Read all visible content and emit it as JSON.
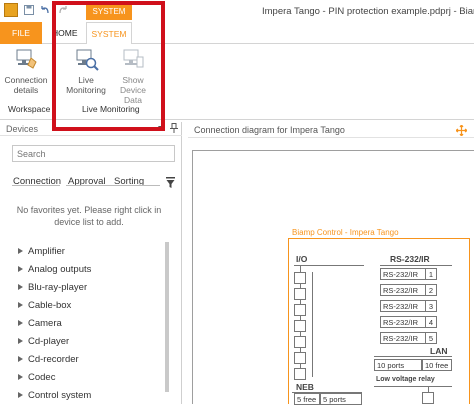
{
  "window": {
    "title": "Impera Tango - PIN protection example.pdprj - Biamp"
  },
  "ribbon": {
    "context_tab_header": "SYSTEM",
    "tabs": [
      {
        "label": "FILE"
      },
      {
        "label": "HOME"
      },
      {
        "label": "SYSTEM"
      }
    ],
    "workspace_group": {
      "label": "Workspace",
      "connection_details": "Connection details"
    },
    "live_monitoring_group": {
      "label": "Live Monitoring",
      "live_monitoring": "Live Monitoring",
      "show_device_data": "Show Device Data"
    }
  },
  "devices_panel": {
    "title": "Devices",
    "search_placeholder": "Search",
    "filters": [
      "Connection",
      "Approval",
      "Sorting"
    ],
    "no_favorites": "No favorites yet. Please right click in device list to add.",
    "items": [
      "Amplifier",
      "Analog outputs",
      "Blu-ray-player",
      "Cable-box",
      "Camera",
      "Cd-player",
      "Cd-recorder",
      "Codec",
      "Control system"
    ]
  },
  "diagram": {
    "title": "Connection diagram for Impera Tango",
    "device_title": "Biamp Control - Impera Tango",
    "sections": {
      "io": "I/O",
      "rs232": "RS-232/IR",
      "lan": "LAN",
      "neb": "NEB",
      "low_voltage_relay": "Low voltage relay"
    },
    "rs232_ports": [
      {
        "label": "RS-232/IR",
        "num": "1"
      },
      {
        "label": "RS-232/IR",
        "num": "2"
      },
      {
        "label": "RS-232/IR",
        "num": "3"
      },
      {
        "label": "RS-232/IR",
        "num": "4"
      },
      {
        "label": "RS-232/IR",
        "num": "5"
      }
    ],
    "lan_ports": {
      "total": "10 ports",
      "free": "10 free"
    },
    "neb_ports": {
      "free": "5 free",
      "total": "5 ports"
    }
  },
  "colors": {
    "accent": "#f7941d",
    "highlight_frame": "#d0101b"
  }
}
